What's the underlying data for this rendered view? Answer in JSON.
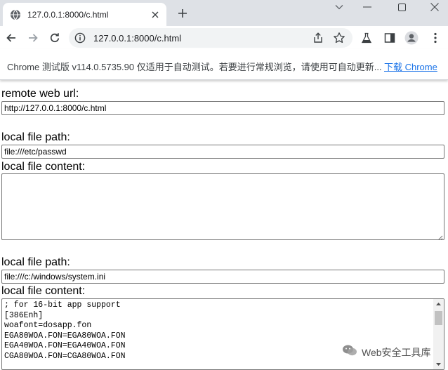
{
  "browser": {
    "tab": {
      "title": "127.0.0.1:8000/c.html",
      "favicon": "globe-icon"
    },
    "address_bar": {
      "url": "127.0.0.1:8000/c.html"
    },
    "infobar": {
      "message": "Chrome 测试版 v114.0.5735.90 仅适用于自动测试。若要进行常规浏览，请使用可自动更新...",
      "link": "下载 Chrome"
    }
  },
  "form": {
    "remote_url": {
      "label": "remote web url:",
      "value": "http://127.0.0.1:8000/c.html"
    },
    "file1": {
      "path_label": "local file path:",
      "path_value": "file:///etc/passwd",
      "content_label": "local file content:",
      "content_value": ""
    },
    "file2": {
      "path_label": "local file path:",
      "path_value": "file:///c:/windows/system.ini",
      "content_label": "local file content:",
      "content_value": "; for 16-bit app support\n[386Enh]\nwoafont=dosapp.fon\nEGA80WOA.FON=EGA80WOA.FON\nEGA40WOA.FON=EGA40WOA.FON\nCGA80WOA.FON=CGA80WOA.FON"
    }
  },
  "watermark": {
    "text": "Web安全工具库"
  },
  "colors": {
    "tabstrip": "#dee1e6",
    "omnibox": "#f1f3f4",
    "link": "#1a73e8",
    "icon": "#5f6368"
  }
}
